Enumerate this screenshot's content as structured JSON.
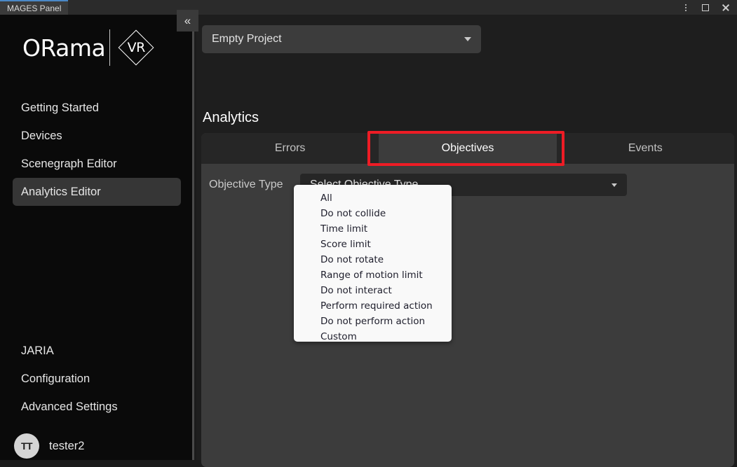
{
  "window": {
    "tab_title": "MAGES Panel",
    "controls": [
      {
        "name": "more-options",
        "glyph": "dots"
      },
      {
        "name": "maximize",
        "glyph": "square"
      },
      {
        "name": "close",
        "glyph": "x"
      }
    ]
  },
  "sidebar": {
    "logo": {
      "text": "ORama",
      "badge": "VR"
    },
    "collapse_icon": "«",
    "items": [
      {
        "label": "Getting Started",
        "active": false
      },
      {
        "label": "Devices",
        "active": false
      },
      {
        "label": "Scenegraph Editor",
        "active": false
      },
      {
        "label": "Analytics Editor",
        "active": true
      }
    ],
    "bottom_items": [
      {
        "label": "JARIA"
      },
      {
        "label": "Configuration"
      },
      {
        "label": "Advanced Settings"
      }
    ],
    "account": {
      "initials": "TT",
      "name": "tester2"
    }
  },
  "main": {
    "project_selector": {
      "value": "Empty Project"
    },
    "section_title": "Analytics",
    "tabs": [
      {
        "label": "Errors",
        "active": false
      },
      {
        "label": "Objectives",
        "active": true
      },
      {
        "label": "Events",
        "active": false
      }
    ],
    "highlight_color": "#ee1c25",
    "form": {
      "objective_type_label": "Objective Type",
      "objective_type_value": "Select Objective Type"
    },
    "dropdown_options": [
      "All",
      "Do not collide",
      "Time limit",
      "Score limit",
      "Do not rotate",
      "Range of motion limit",
      "Do not interact",
      "Perform required action",
      "Do not perform action",
      "Custom"
    ]
  }
}
